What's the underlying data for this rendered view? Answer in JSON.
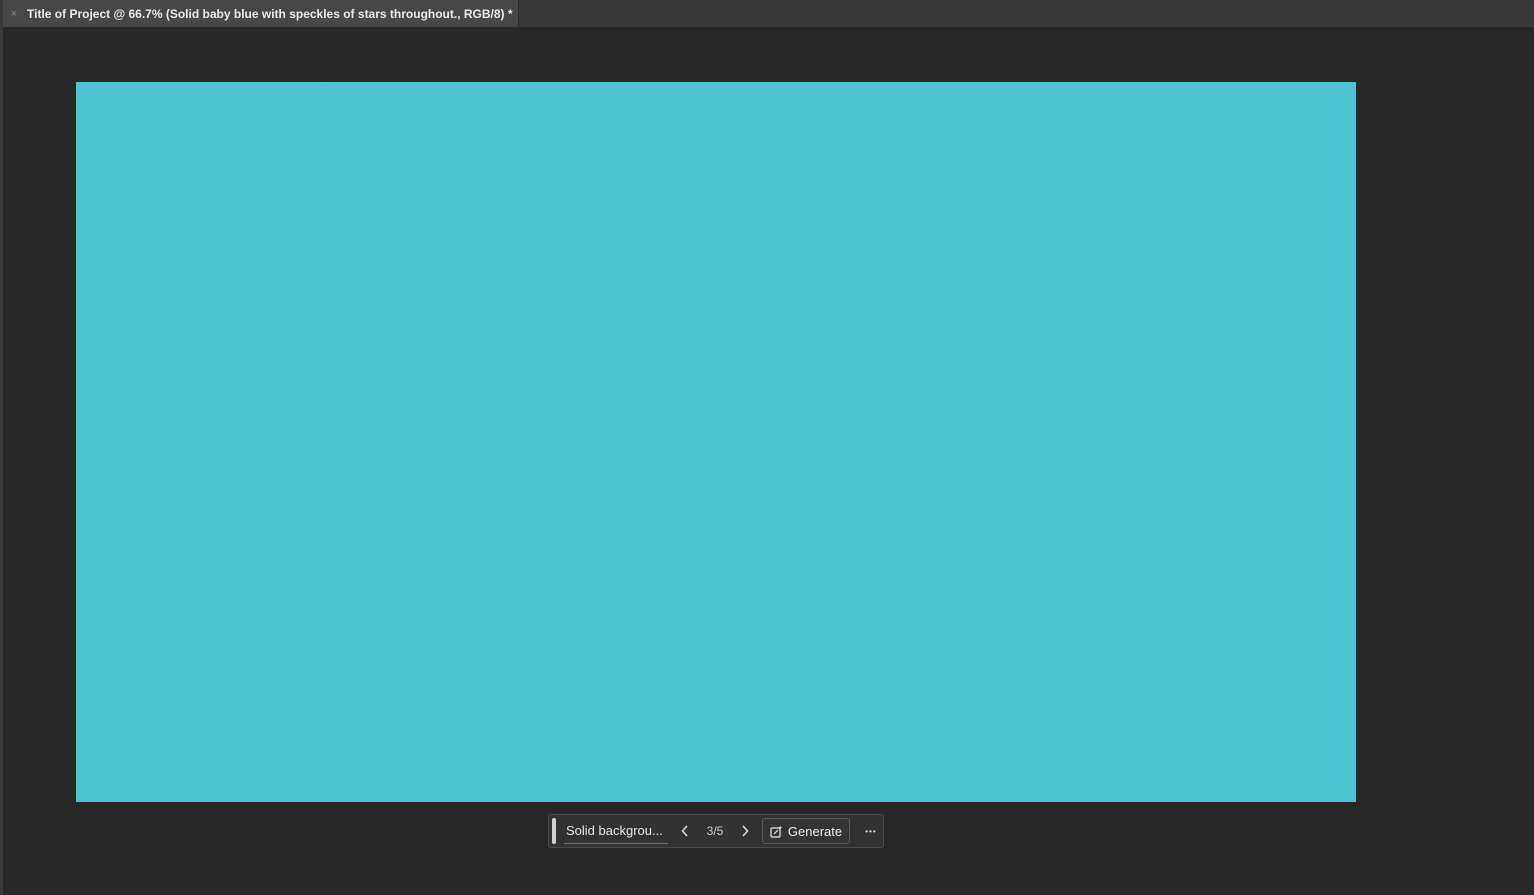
{
  "document": {
    "tab_title": "Title of Project @ 66.7% (Solid baby blue with speckles of stars throughout., RGB/8) *",
    "close_glyph": "×",
    "canvas_color": "#4ec8d8"
  },
  "contextual_bar": {
    "prompt_text": "Solid backgrou...",
    "prev_glyph": "‹",
    "next_glyph": "›",
    "variation_counter": "3/5",
    "generate_label": "Generate",
    "more_glyph": "•••"
  },
  "colors": {
    "workspace": "#282828",
    "tabbar": "#393939",
    "canvas_fill": "#4ec8d8"
  },
  "icons": [
    "close-icon",
    "chevron-left-icon",
    "chevron-right-icon",
    "generate-icon",
    "more-options-icon"
  ]
}
